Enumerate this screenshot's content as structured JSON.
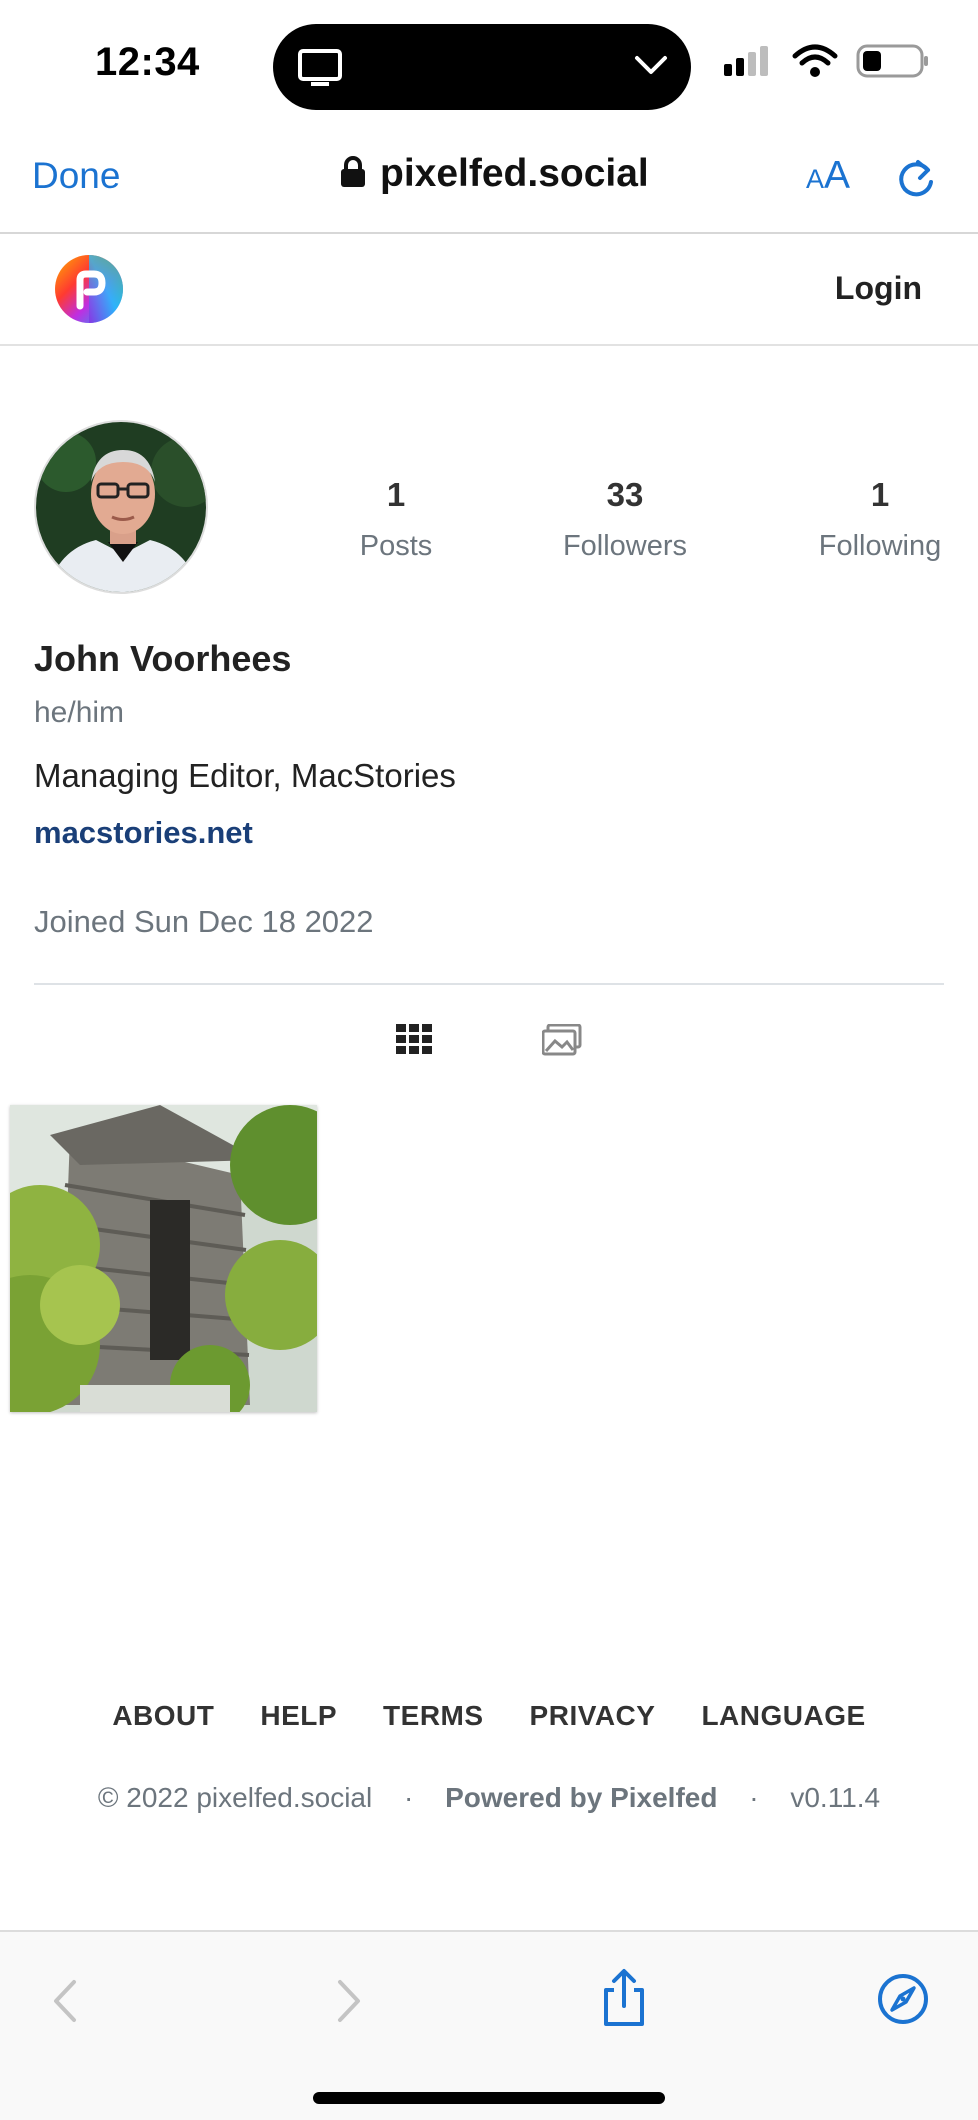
{
  "status_bar": {
    "time": "12:34"
  },
  "browser": {
    "done_label": "Done",
    "url": "pixelfed.social",
    "text_size_label_small": "A",
    "text_size_label_large": "A"
  },
  "site_nav": {
    "login_label": "Login"
  },
  "profile": {
    "stats": [
      {
        "count": "1",
        "label": "Posts"
      },
      {
        "count": "33",
        "label": "Followers"
      },
      {
        "count": "1",
        "label": "Following"
      }
    ],
    "name": "John Voorhees",
    "pronouns": "he/him",
    "bio": "Managing Editor, MacStories",
    "website": "macstories.net",
    "joined": "Joined Sun Dec 18 2022"
  },
  "footer": {
    "links": [
      "ABOUT",
      "HELP",
      "TERMS",
      "PRIVACY",
      "LANGUAGE"
    ],
    "copyright": "© 2022 pixelfed.social",
    "powered_by": "Powered by Pixelfed",
    "version": "v0.11.4",
    "separator": "·"
  },
  "colors": {
    "safari_blue": "#1b73d1",
    "link_navy": "#1a3f78",
    "muted_gray": "#6c757d"
  }
}
